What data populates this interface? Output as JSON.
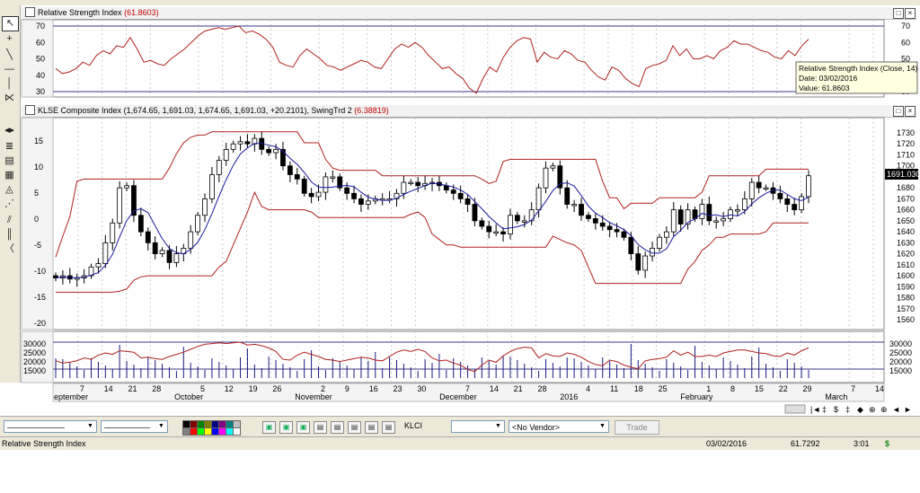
{
  "rsi_pane": {
    "title": "Relative Strength Index",
    "value": "(61.8603)",
    "y_ticks": [
      "70",
      "60",
      "50",
      "40",
      "30"
    ],
    "right_ticks": [
      "70",
      "60",
      "50",
      "40",
      "30"
    ],
    "tooltip": [
      "Relative Strength Index (Close, 14)",
      "Date: 03/02/2016",
      "Value: 61.8603"
    ],
    "values": [
      44,
      41,
      42,
      44,
      48,
      46,
      52,
      55,
      53,
      58,
      57,
      63,
      56,
      48,
      49,
      47,
      46,
      50,
      53,
      56,
      60,
      64,
      67,
      68,
      69,
      68,
      69,
      70,
      66,
      67,
      65,
      62,
      57,
      48,
      46,
      45,
      52,
      56,
      53,
      50,
      46,
      45,
      43,
      45,
      47,
      49,
      48,
      45,
      44,
      50,
      56,
      59,
      57,
      60,
      57,
      52,
      48,
      44,
      45,
      41,
      38,
      32,
      29,
      38,
      45,
      42,
      51,
      57,
      61,
      63,
      62,
      48,
      54,
      51,
      50,
      55,
      53,
      49,
      48,
      43,
      39,
      37,
      45,
      43,
      38,
      35,
      33,
      44,
      46,
      47,
      49,
      58,
      52,
      56,
      50,
      50,
      52,
      50,
      55,
      57,
      61,
      59,
      59,
      57,
      55,
      54,
      51,
      50,
      55,
      52,
      58,
      62
    ]
  },
  "price_pane": {
    "title": "KLSE Composite Index",
    "ohlc": "(1,674.65, 1,691.03, 1,674.65, 1,691.03, +20.2101),",
    "indicator": "SwingTrd 2",
    "indicator_value": "(6.38819)",
    "left_ticks": [
      "15",
      "10",
      "5",
      "0",
      "-5",
      "-10",
      "-15",
      "-20"
    ],
    "right_ticks": [
      "1730",
      "1720",
      "1710",
      "1700",
      "1690",
      "1680",
      "1670",
      "1660",
      "1650",
      "1640",
      "1630",
      "1620",
      "1610",
      "1600",
      "1590",
      "1580",
      "1570",
      "1560"
    ],
    "last_price": "1691.030",
    "closes": [
      1598,
      1600,
      1597,
      1598,
      1600,
      1608,
      1611,
      1630,
      1648,
      1680,
      1682,
      1655,
      1640,
      1630,
      1620,
      1623,
      1612,
      1620,
      1625,
      1640,
      1655,
      1670,
      1692,
      1705,
      1715,
      1720,
      1722,
      1720,
      1725,
      1715,
      1712,
      1715,
      1700,
      1692,
      1688,
      1675,
      1672,
      1676,
      1690,
      1690,
      1680,
      1675,
      1670,
      1665,
      1668,
      1670,
      1670,
      1670,
      1675,
      1685,
      1685,
      1682,
      1684,
      1685,
      1682,
      1678,
      1675,
      1670,
      1665,
      1650,
      1645,
      1640,
      1640,
      1638,
      1655,
      1650,
      1650,
      1660,
      1680,
      1698,
      1700,
      1680,
      1665,
      1665,
      1655,
      1652,
      1648,
      1645,
      1642,
      1640,
      1635,
      1620,
      1605,
      1618,
      1625,
      1635,
      1640,
      1660,
      1647,
      1660,
      1652,
      1665,
      1650,
      1650,
      1652,
      1660,
      1660,
      1670,
      1685,
      1680,
      1680,
      1675,
      1670,
      1665,
      1660,
      1672,
      1691
    ]
  },
  "volume_pane": {
    "left_ticks": [
      "30000",
      "25000",
      "20000",
      "15000"
    ],
    "right_ticks": [
      "30000",
      "25000",
      "20000",
      "15000"
    ]
  },
  "date_axis": [
    "eptember",
    "7",
    "14",
    "21",
    "28",
    "October",
    "5",
    "12",
    "19",
    "26",
    "November",
    "2",
    "9",
    "16",
    "23",
    "30",
    "December",
    "7",
    "14",
    "21",
    "28",
    "2016",
    "4",
    "11",
    "18",
    "25",
    "February",
    "1",
    "8",
    "15",
    "22",
    "29",
    "March",
    "7",
    "14"
  ],
  "toolbar": {
    "symbol": "KLCI",
    "vendor": "<No Vendor>",
    "trade_label": "Trade",
    "swatch_colors": [
      "#000000",
      "#800000",
      "#008000",
      "#808000",
      "#000080",
      "#800080",
      "#008080",
      "#c0c0c0",
      "#808080",
      "#ff0000",
      "#00ff00",
      "#ffff00",
      "#0000ff",
      "#ff00ff",
      "#00ffff",
      "#ffffff"
    ]
  },
  "nav_buttons": [
    "|◄",
    "‡",
    "$",
    "‡",
    "◆",
    "⊕",
    "⊕",
    "◄",
    "►"
  ],
  "status": {
    "left": "Relative Strength Index",
    "date": "03/02/2016",
    "value": "61.7292",
    "time": "3:01",
    "currency": "$"
  }
}
